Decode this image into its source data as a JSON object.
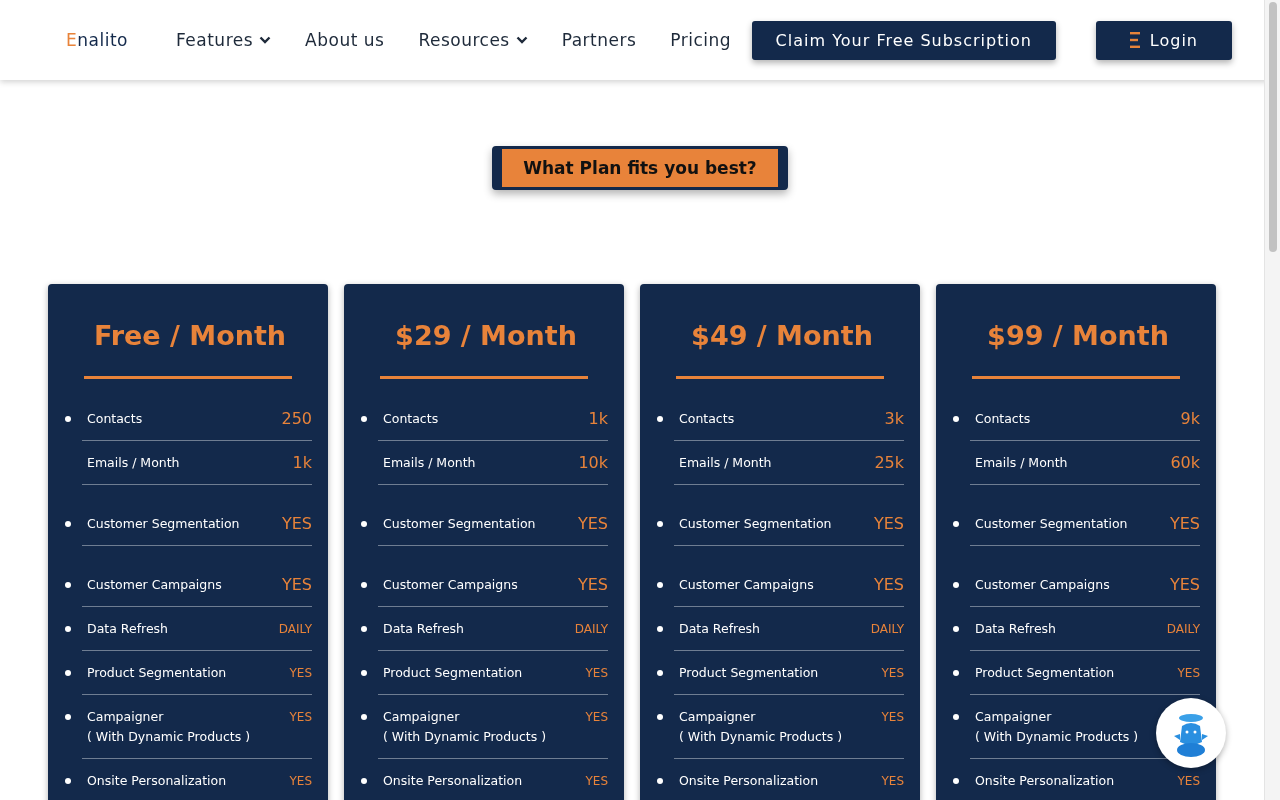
{
  "nav": {
    "logo": "Enalito",
    "links": [
      {
        "label": "Features",
        "dropdown": true
      },
      {
        "label": "About us",
        "dropdown": false
      },
      {
        "label": "Resources",
        "dropdown": true
      },
      {
        "label": "Partners",
        "dropdown": false
      },
      {
        "label": "Pricing",
        "dropdown": false
      }
    ],
    "cta": "Claim Your Free Subscription",
    "login": "Login"
  },
  "heading": "What Plan fits you best?",
  "plans": [
    {
      "title": "Free / Month",
      "rows": [
        {
          "kind": "count",
          "bullet": true,
          "label": "Contacts",
          "value": "250"
        },
        {
          "kind": "count",
          "bullet": false,
          "label": "Emails / Month",
          "value": "1k"
        },
        {
          "kind": "feature",
          "bullet": true,
          "label": "Customer Segmentation",
          "value": "YES"
        },
        {
          "kind": "feature",
          "bullet": true,
          "label": "Customer Campaigns",
          "value": "YES"
        },
        {
          "kind": "detail",
          "bullet": true,
          "label": "Data Refresh",
          "value": "DAILY"
        },
        {
          "kind": "detail",
          "bullet": true,
          "label": "Product Segmentation",
          "value": "YES"
        },
        {
          "kind": "detail",
          "bullet": true,
          "label": "Campaigner",
          "sublabel": "( With Dynamic Products )",
          "value": "YES"
        },
        {
          "kind": "detail",
          "bullet": true,
          "label": "Onsite Personalization",
          "value": "YES"
        }
      ]
    },
    {
      "title": "$29 / Month",
      "rows": [
        {
          "kind": "count",
          "bullet": true,
          "label": "Contacts",
          "value": "1k"
        },
        {
          "kind": "count",
          "bullet": false,
          "label": "Emails / Month",
          "value": "10k"
        },
        {
          "kind": "feature",
          "bullet": true,
          "label": "Customer Segmentation",
          "value": "YES"
        },
        {
          "kind": "feature",
          "bullet": true,
          "label": "Customer Campaigns",
          "value": "YES"
        },
        {
          "kind": "detail",
          "bullet": true,
          "label": "Data Refresh",
          "value": "DAILY"
        },
        {
          "kind": "detail",
          "bullet": true,
          "label": "Product Segmentation",
          "value": "YES"
        },
        {
          "kind": "detail",
          "bullet": true,
          "label": "Campaigner",
          "sublabel": "( With Dynamic Products )",
          "value": "YES"
        },
        {
          "kind": "detail",
          "bullet": true,
          "label": "Onsite Personalization",
          "value": "YES"
        }
      ]
    },
    {
      "title": "$49 / Month",
      "rows": [
        {
          "kind": "count",
          "bullet": true,
          "label": "Contacts",
          "value": "3k"
        },
        {
          "kind": "count",
          "bullet": false,
          "label": "Emails / Month",
          "value": "25k"
        },
        {
          "kind": "feature",
          "bullet": true,
          "label": "Customer Segmentation",
          "value": "YES"
        },
        {
          "kind": "feature",
          "bullet": true,
          "label": "Customer Campaigns",
          "value": "YES"
        },
        {
          "kind": "detail",
          "bullet": true,
          "label": "Data Refresh",
          "value": "DAILY"
        },
        {
          "kind": "detail",
          "bullet": true,
          "label": "Product Segmentation",
          "value": "YES"
        },
        {
          "kind": "detail",
          "bullet": true,
          "label": "Campaigner",
          "sublabel": "( With Dynamic Products )",
          "value": "YES"
        },
        {
          "kind": "detail",
          "bullet": true,
          "label": "Onsite Personalization",
          "value": "YES"
        }
      ]
    },
    {
      "title": "$99 / Month",
      "rows": [
        {
          "kind": "count",
          "bullet": true,
          "label": "Contacts",
          "value": "9k"
        },
        {
          "kind": "count",
          "bullet": false,
          "label": "Emails / Month",
          "value": "60k"
        },
        {
          "kind": "feature",
          "bullet": true,
          "label": "Customer Segmentation",
          "value": "YES"
        },
        {
          "kind": "feature",
          "bullet": true,
          "label": "Customer Campaigns",
          "value": "YES"
        },
        {
          "kind": "detail",
          "bullet": true,
          "label": "Data Refresh",
          "value": "DAILY"
        },
        {
          "kind": "detail",
          "bullet": true,
          "label": "Product Segmentation",
          "value": "YES"
        },
        {
          "kind": "detail",
          "bullet": true,
          "label": "Campaigner",
          "sublabel": "( With Dynamic Products )"
        },
        {
          "kind": "detail",
          "bullet": true,
          "label": "Onsite Personalization",
          "value": "YES"
        }
      ]
    }
  ]
}
